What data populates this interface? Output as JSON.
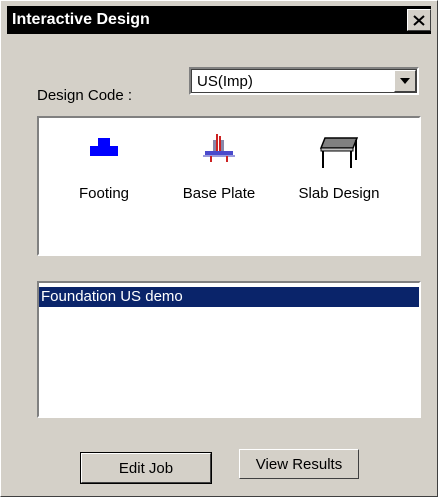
{
  "window": {
    "title": "Interactive Design"
  },
  "design_code": {
    "label": "Design Code :",
    "selected": "US(Imp)"
  },
  "tools": [
    {
      "label": "Footing",
      "icon": "footing-icon"
    },
    {
      "label": "Base Plate",
      "icon": "base-plate-icon"
    },
    {
      "label": "Slab Design",
      "icon": "slab-design-icon"
    }
  ],
  "jobs": {
    "items": [
      "Foundation US demo"
    ],
    "selected_index": 0
  },
  "buttons": {
    "edit_job": "Edit Job",
    "view_results": "View Results"
  },
  "colors": {
    "face": "#d4d0c8",
    "selection": "#0a246a",
    "footing_blue": "#0000ff"
  }
}
